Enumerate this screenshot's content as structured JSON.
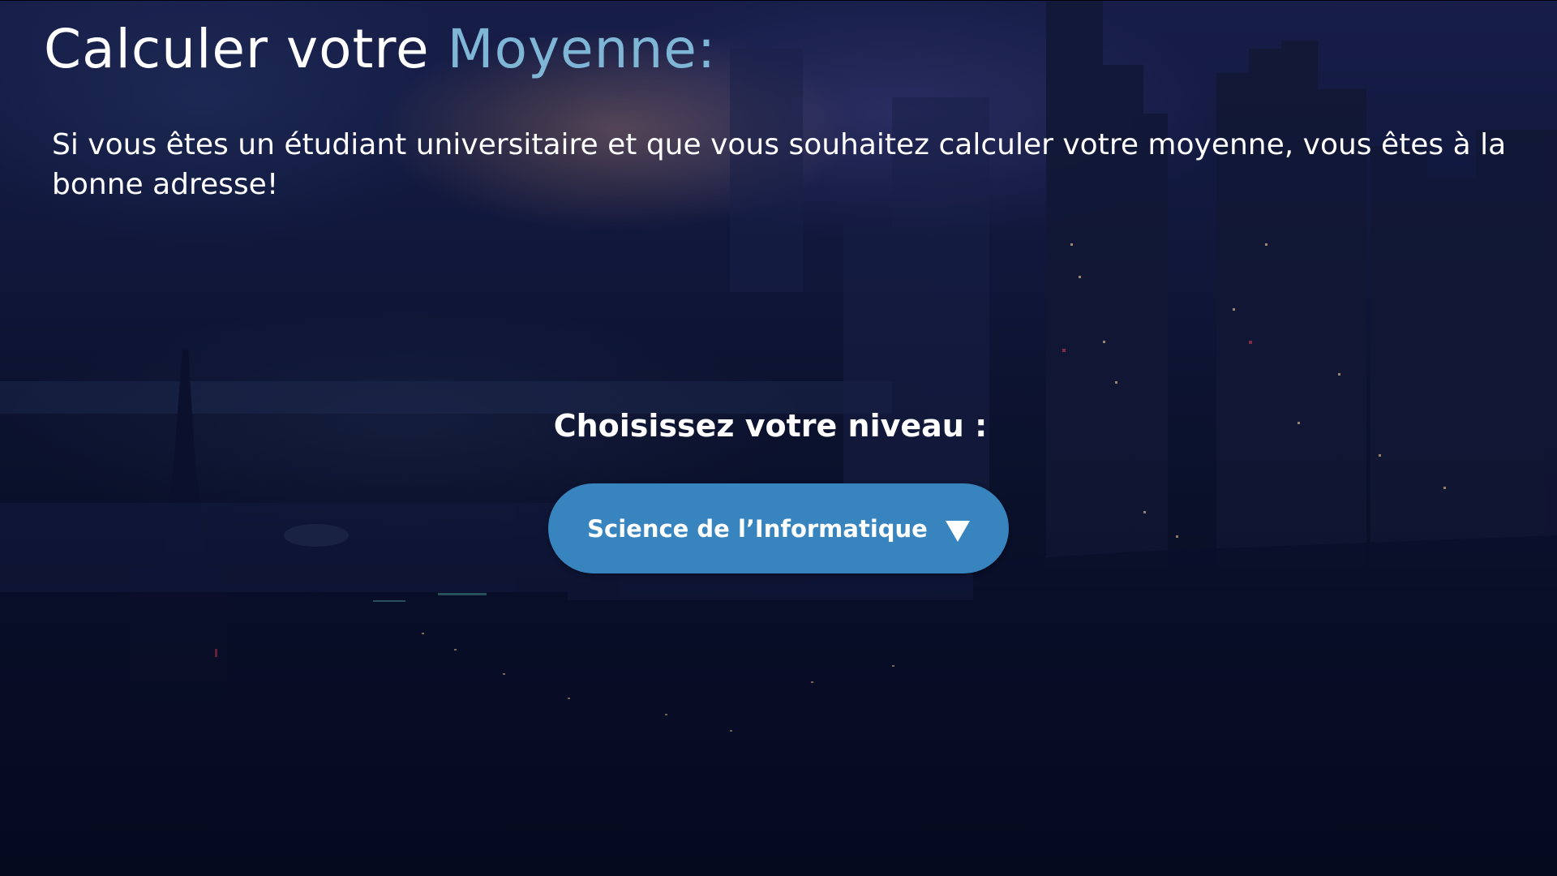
{
  "header": {
    "title_main": "Calculer votre",
    "title_accent": "Moyenne:",
    "accent_color": "#7fb6d6"
  },
  "intro": {
    "text": "Si vous êtes un étudiant universitaire et que vous souhaitez calculer votre moyenne, vous êtes à la bonne adresse!"
  },
  "level_selector": {
    "label": "Choisissez votre niveau :",
    "selected_value": "Science de l’Informatique",
    "button_color": "#3784bf",
    "arrow_icon": "triangle-down-icon"
  }
}
